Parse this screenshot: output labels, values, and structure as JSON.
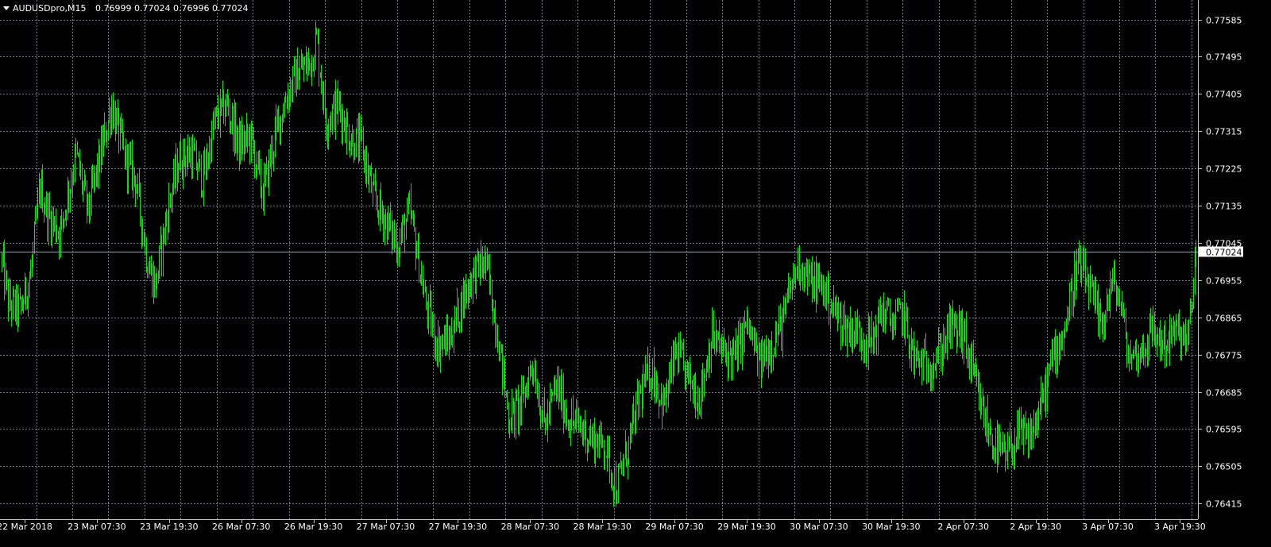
{
  "header": {
    "symbol_timeframe": "AUDUSDpro,M15",
    "ohlc": "0.76999 0.77024 0.76996 0.77024",
    "menu_icon": "triangle-down-icon"
  },
  "colors": {
    "background": "#000000",
    "bars": "#00e600",
    "grid": "#6f7f90",
    "text": "#ffffff",
    "current_price_line": "#8ca0b4"
  },
  "chart_data": {
    "type": "bar",
    "symbol": "AUDUSDpro",
    "timeframe": "M15",
    "current_price": 0.77024,
    "current_price_label": "0.77024",
    "ylim": [
      0.7637,
      0.7763
    ],
    "y_ticks": [
      "0.77585",
      "0.77495",
      "0.77405",
      "0.77315",
      "0.77225",
      "0.77135",
      "0.77045",
      "0.76955",
      "0.76865",
      "0.76775",
      "0.76685",
      "0.76595",
      "0.76505",
      "0.76415"
    ],
    "x_ticks": [
      "22 Mar 2018",
      "23 Mar 07:30",
      "23 Mar 19:30",
      "26 Mar 07:30",
      "26 Mar 19:30",
      "27 Mar 07:30",
      "27 Mar 19:30",
      "28 Mar 07:30",
      "28 Mar 19:30",
      "29 Mar 07:30",
      "29 Mar 19:30",
      "30 Mar 07:30",
      "30 Mar 19:30",
      "2 Apr 07:30",
      "2 Apr 19:30",
      "3 Apr 07:30",
      "3 Apr 19:30"
    ],
    "grid": true,
    "series": [
      {
        "price_path": [
          [
            0,
            0.7702
          ],
          [
            10,
            0.769
          ],
          [
            25,
            0.7688
          ],
          [
            38,
            0.7697
          ],
          [
            50,
            0.7718
          ],
          [
            60,
            0.7711
          ],
          [
            75,
            0.7707
          ],
          [
            95,
            0.7726
          ],
          [
            110,
            0.7712
          ],
          [
            125,
            0.7725
          ],
          [
            140,
            0.7738
          ],
          [
            155,
            0.7726
          ],
          [
            170,
            0.772
          ],
          [
            185,
            0.77
          ],
          [
            195,
            0.7694
          ],
          [
            210,
            0.7712
          ],
          [
            225,
            0.7725
          ],
          [
            240,
            0.7726
          ],
          [
            255,
            0.772
          ],
          [
            270,
            0.7734
          ],
          [
            285,
            0.7738
          ],
          [
            300,
            0.7728
          ],
          [
            315,
            0.773
          ],
          [
            330,
            0.7716
          ],
          [
            345,
            0.773
          ],
          [
            360,
            0.774
          ],
          [
            375,
            0.7746
          ],
          [
            390,
            0.7748
          ],
          [
            398,
            0.7754
          ],
          [
            410,
            0.7734
          ],
          [
            425,
            0.7738
          ],
          [
            440,
            0.773
          ],
          [
            455,
            0.7728
          ],
          [
            470,
            0.7715
          ],
          [
            485,
            0.771
          ],
          [
            500,
            0.7704
          ],
          [
            515,
            0.7712
          ],
          [
            525,
            0.7702
          ],
          [
            535,
            0.769
          ],
          [
            550,
            0.768
          ],
          [
            565,
            0.7681
          ],
          [
            580,
            0.769
          ],
          [
            595,
            0.7697
          ],
          [
            610,
            0.77
          ],
          [
            625,
            0.7684
          ],
          [
            640,
            0.7662
          ],
          [
            655,
            0.7665
          ],
          [
            670,
            0.7676
          ],
          [
            685,
            0.766
          ],
          [
            700,
            0.767
          ],
          [
            715,
            0.7662
          ],
          [
            730,
            0.766
          ],
          [
            745,
            0.7657
          ],
          [
            760,
            0.7656
          ],
          [
            775,
            0.7645
          ],
          [
            790,
            0.7655
          ],
          [
            805,
            0.7668
          ],
          [
            820,
            0.7674
          ],
          [
            835,
            0.7665
          ],
          [
            850,
            0.7678
          ],
          [
            865,
            0.7672
          ],
          [
            880,
            0.7667
          ],
          [
            895,
            0.7682
          ],
          [
            910,
            0.7678
          ],
          [
            925,
            0.7677
          ],
          [
            940,
            0.7685
          ],
          [
            955,
            0.7675
          ],
          [
            970,
            0.768
          ],
          [
            985,
            0.7685
          ],
          [
            995,
            0.7694
          ],
          [
            1005,
            0.77
          ],
          [
            1020,
            0.7695
          ],
          [
            1035,
            0.7694
          ],
          [
            1050,
            0.7688
          ],
          [
            1065,
            0.7684
          ],
          [
            1080,
            0.7683
          ],
          [
            1095,
            0.768
          ],
          [
            1110,
            0.7688
          ],
          [
            1125,
            0.7685
          ],
          [
            1135,
            0.7688
          ],
          [
            1150,
            0.7676
          ],
          [
            1165,
            0.7675
          ],
          [
            1180,
            0.7677
          ],
          [
            1195,
            0.7684
          ],
          [
            1210,
            0.7683
          ],
          [
            1220,
            0.7676
          ],
          [
            1235,
            0.7664
          ],
          [
            1250,
            0.7656
          ],
          [
            1265,
            0.7652
          ],
          [
            1280,
            0.7658
          ],
          [
            1295,
            0.7657
          ],
          [
            1310,
            0.7665
          ],
          [
            1325,
            0.7677
          ],
          [
            1340,
            0.7684
          ],
          [
            1355,
            0.7699
          ],
          [
            1370,
            0.7694
          ],
          [
            1385,
            0.7684
          ],
          [
            1400,
            0.7695
          ],
          [
            1410,
            0.769
          ],
          [
            1420,
            0.7677
          ],
          [
            1435,
            0.7678
          ],
          [
            1450,
            0.7683
          ],
          [
            1465,
            0.768
          ],
          [
            1480,
            0.7683
          ],
          [
            1495,
            0.768
          ],
          [
            1505,
            0.7702
          ]
        ]
      }
    ]
  }
}
